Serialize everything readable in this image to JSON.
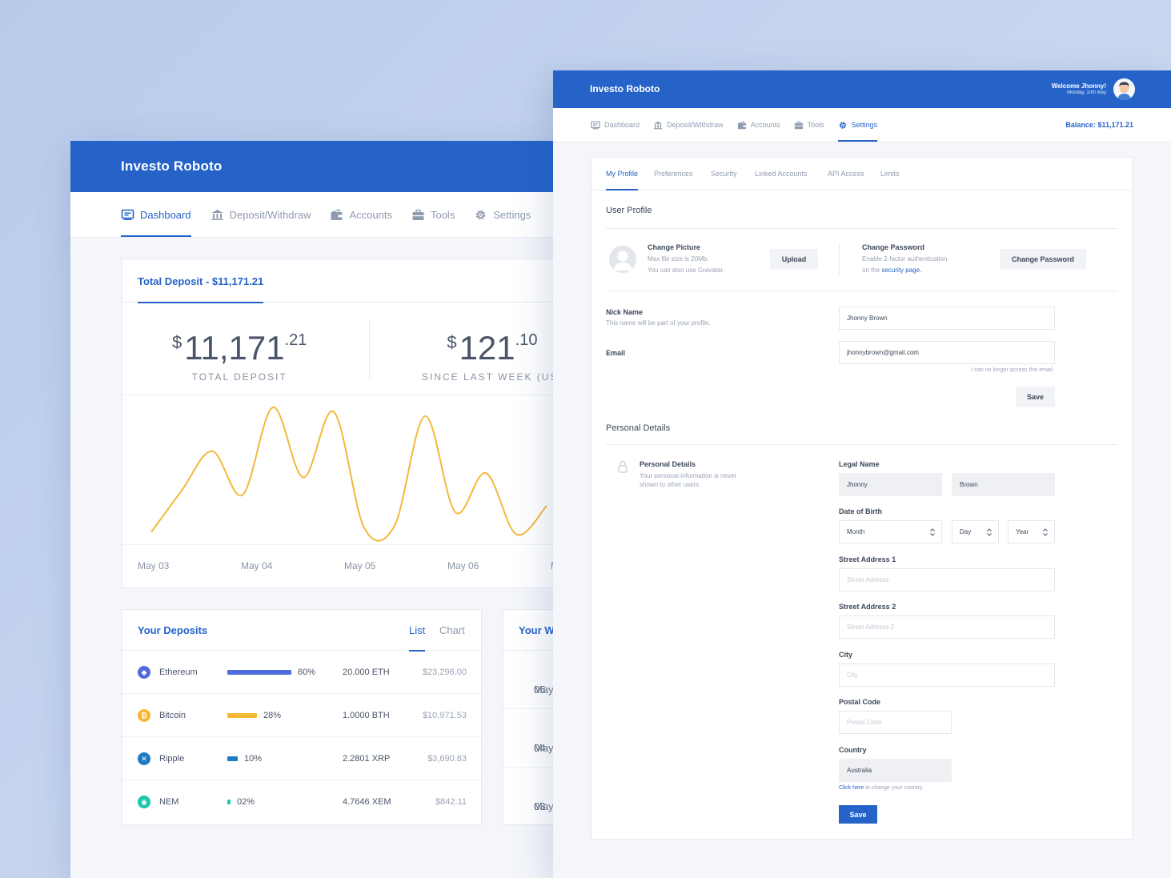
{
  "dashboard": {
    "app_title": "Investo Roboto",
    "nav": [
      {
        "label": "Dashboard",
        "icon": "dashboard-icon",
        "active": true
      },
      {
        "label": "Deposit/Withdraw",
        "icon": "bank-icon",
        "active": false
      },
      {
        "label": "Accounts",
        "icon": "wallet-icon",
        "active": false
      },
      {
        "label": "Tools",
        "icon": "toolbox-icon",
        "active": false
      },
      {
        "label": "Settings",
        "icon": "gear-icon",
        "active": false
      }
    ],
    "deposit_card": {
      "tab_label": "Total Deposit - $11,171.21",
      "stat1": {
        "currency": "$",
        "whole": "11,171",
        "cents": ".21",
        "label": "TOTAL DEPOSIT"
      },
      "stat2": {
        "currency": "$",
        "whole": "121",
        "cents": ".10",
        "label": "SINCE LAST WEEK (USI"
      },
      "x_labels": [
        "May 03",
        "May 04",
        "May 05",
        "May 06",
        "M"
      ]
    },
    "chart_data": {
      "type": "line",
      "series": [
        {
          "values": [
            3,
            22,
            40,
            20,
            60,
            28,
            58,
            5,
            6,
            56,
            12,
            30,
            2,
            15
          ]
        }
      ],
      "line_color": "#f2b93b",
      "grid": false,
      "x": [
        "May 03",
        "May 04",
        "May 05",
        "May 06",
        "M"
      ]
    },
    "deposits": {
      "title": "Your Deposits",
      "tab_list": "List",
      "tab_chart": "Chart",
      "rows": [
        {
          "name": "Ethereum",
          "percent_value": 60,
          "percent": "60%",
          "amount": "20.000 ETH",
          "usd": "$23,296.00",
          "color": "#4f6bdc",
          "icon": "ethereum-icon",
          "glyph": "◆"
        },
        {
          "name": "Bitcoin",
          "percent_value": 28,
          "percent": "28%",
          "amount": "1.0000 BTH",
          "usd": "$10,971.53",
          "color": "#f6b935",
          "icon": "bitcoin-icon",
          "glyph": "₿"
        },
        {
          "name": "Ripple",
          "percent_value": 10,
          "percent": "10%",
          "amount": "2.2801 XRP",
          "usd": "$3,690.83",
          "color": "#1d7bc4",
          "icon": "ripple-icon",
          "glyph": "✕"
        },
        {
          "name": "NEM",
          "percent_value": 2,
          "percent": "02%",
          "amount": "4.7646 XEM",
          "usd": "$842.11",
          "color": "#1bc6a8",
          "icon": "nem-icon",
          "glyph": "◉"
        }
      ]
    },
    "your_w": {
      "title": "Your W",
      "cells": [
        {
          "month": "May",
          "day": "05"
        },
        {
          "month": "May",
          "day": "04"
        },
        {
          "month": "May",
          "day": "03"
        }
      ]
    }
  },
  "settings": {
    "app_title": "Investo Roboto",
    "welcome": "Welcome Jhonny!",
    "date": "Monday, 10th May",
    "balance": "Balance: $11,171.21",
    "nav": [
      {
        "label": "Dashboard",
        "icon": "dashboard-icon",
        "active": false
      },
      {
        "label": "Deposit/Withdraw",
        "icon": "bank-icon",
        "active": false
      },
      {
        "label": "Accounts",
        "icon": "wallet-icon",
        "active": false
      },
      {
        "label": "Tools",
        "icon": "toolbox-icon",
        "active": false
      },
      {
        "label": "Settings",
        "icon": "gear-icon",
        "active": true
      }
    ],
    "subtabs": [
      "My Profile",
      "Preferences",
      "Security",
      "Linked Accounts",
      "API Access",
      "Limits"
    ],
    "user_profile": {
      "title": "User Profile",
      "change_picture": "Change Picture",
      "pic_line1": "Max file size is 20Mb.",
      "pic_line2": "You can also use Gravatar.",
      "upload": "Upload",
      "change_password_title": "Change Password",
      "pw_line1": "Enable 2-factor authentication",
      "pw_line2_prefix": "on the",
      "pw_link": "security page.",
      "change_password_btn": "Change Password",
      "nick_label": "Nick Name",
      "nick_help": "This name will be part of your profile.",
      "nick_value": "Jhonny Brown",
      "email_label": "Email",
      "email_value": "jhonnybrown@gmail.com",
      "email_hint": "I can no longer access this email.",
      "save": "Save"
    },
    "personal": {
      "title": "Personal Details",
      "side_title": "Personal Details",
      "side_line1": "Your personal information is never",
      "side_line2": "shown to other users.",
      "legal_label": "Legal Name",
      "first": "Jhonny",
      "last": "Brown",
      "dob_label": "Date of Birth",
      "month": "Month",
      "day": "Day",
      "year": "Year",
      "street1_label": "Street Address 1",
      "street1_ph": "Street Address",
      "street2_label": "Street Address 2",
      "street2_ph": "Street Address 2",
      "city_label": "City",
      "city_ph": "City",
      "postal_label": "Postal Code",
      "postal_ph": "Postal Code",
      "country_label": "Country",
      "country_value": "Australia",
      "country_link": "Click here",
      "country_hint": " to change your country.",
      "save": "Save"
    }
  }
}
